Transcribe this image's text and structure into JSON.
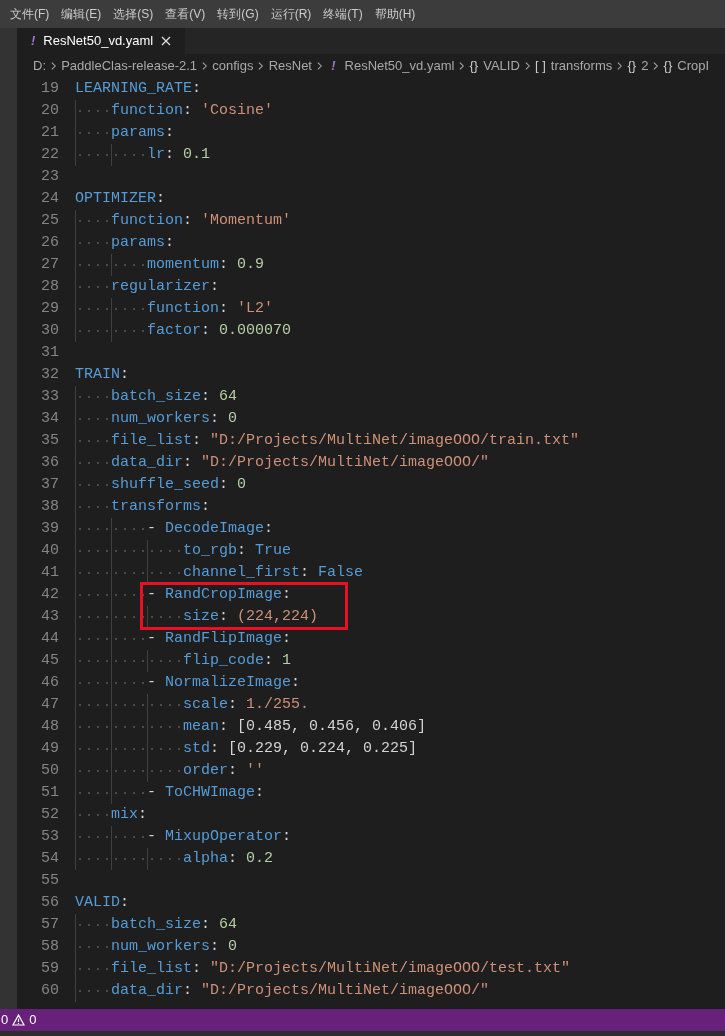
{
  "menu": [
    "文件(F)",
    "编辑(E)",
    "选择(S)",
    "查看(V)",
    "转到(G)",
    "运行(R)",
    "终端(T)",
    "帮助(H)"
  ],
  "tabs": [
    {
      "icon": "!",
      "label": "ResNet50_vd.yaml",
      "selected": true
    }
  ],
  "breadcrumb": [
    {
      "label": "D:"
    },
    {
      "label": "PaddleClas-release-2.1"
    },
    {
      "label": "configs"
    },
    {
      "label": "ResNet"
    },
    {
      "symbol": "!",
      "label": "ResNet50_vd.yaml"
    },
    {
      "symbol": "{}",
      "label": "VALID"
    },
    {
      "symbol": "[ ]",
      "label": "transforms"
    },
    {
      "symbol": "{}",
      "label": "2"
    },
    {
      "symbol": "{}",
      "label": "CropI"
    }
  ],
  "lines": [
    {
      "number": "19",
      "highlighted": false,
      "tokens": [
        {
          "kind": "key",
          "text": "LEARNING_RATE"
        },
        {
          "kind": "punct",
          "text": ":"
        }
      ],
      "children": [
        {
          "number": "20",
          "highlighted": false,
          "tokens": [
            {
              "kind": "key",
              "text": "function"
            },
            {
              "kind": "punct",
              "text": ": "
            },
            {
              "kind": "string",
              "text": "'Cosine'"
            }
          ]
        },
        {
          "number": "21",
          "highlighted": false,
          "tokens": [
            {
              "kind": "key",
              "text": "params"
            },
            {
              "kind": "punct",
              "text": ":"
            }
          ],
          "children": [
            {
              "number": "22",
              "highlighted": false,
              "tokens": [
                {
                  "kind": "key",
                  "text": "lr"
                },
                {
                  "kind": "punct",
                  "text": ": "
                },
                {
                  "kind": "number",
                  "text": "0.1"
                }
              ]
            }
          ]
        }
      ]
    },
    {
      "number": "23",
      "highlighted": false
    },
    {
      "number": "24",
      "highlighted": false,
      "tokens": [
        {
          "kind": "key",
          "text": "OPTIMIZER"
        },
        {
          "kind": "punct",
          "text": ":"
        }
      ],
      "children": [
        {
          "number": "25",
          "highlighted": false,
          "tokens": [
            {
              "kind": "key",
              "text": "function"
            },
            {
              "kind": "punct",
              "text": ": "
            },
            {
              "kind": "string",
              "text": "'Momentum'"
            }
          ]
        },
        {
          "number": "26",
          "highlighted": false,
          "tokens": [
            {
              "kind": "key",
              "text": "params"
            },
            {
              "kind": "punct",
              "text": ":"
            }
          ],
          "children": [
            {
              "number": "27",
              "highlighted": false,
              "tokens": [
                {
                  "kind": "key",
                  "text": "momentum"
                },
                {
                  "kind": "punct",
                  "text": ": "
                },
                {
                  "kind": "number",
                  "text": "0.9"
                }
              ]
            }
          ]
        },
        {
          "number": "28",
          "highlighted": false,
          "tokens": [
            {
              "kind": "key",
              "text": "regularizer"
            },
            {
              "kind": "punct",
              "text": ":"
            }
          ],
          "children": [
            {
              "number": "29",
              "highlighted": false,
              "tokens": [
                {
                  "kind": "key",
                  "text": "function"
                },
                {
                  "kind": "punct",
                  "text": ": "
                },
                {
                  "kind": "string",
                  "text": "'L2'"
                }
              ]
            },
            {
              "number": "30",
              "highlighted": false,
              "tokens": [
                {
                  "kind": "key",
                  "text": "factor"
                },
                {
                  "kind": "punct",
                  "text": ": "
                },
                {
                  "kind": "number",
                  "text": "0.000070"
                }
              ]
            }
          ]
        }
      ]
    },
    {
      "number": "31",
      "highlighted": false
    },
    {
      "number": "32",
      "highlighted": false,
      "tokens": [
        {
          "kind": "key",
          "text": "TRAIN"
        },
        {
          "kind": "punct",
          "text": ":"
        }
      ],
      "children": [
        {
          "number": "33",
          "highlighted": false,
          "tokens": [
            {
              "kind": "key",
              "text": "batch_size"
            },
            {
              "kind": "punct",
              "text": ": "
            },
            {
              "kind": "number",
              "text": "64"
            }
          ]
        },
        {
          "number": "34",
          "highlighted": false,
          "tokens": [
            {
              "kind": "key",
              "text": "num_workers"
            },
            {
              "kind": "punct",
              "text": ": "
            },
            {
              "kind": "number",
              "text": "0"
            }
          ]
        },
        {
          "number": "35",
          "highlighted": false,
          "tokens": [
            {
              "kind": "key",
              "text": "file_list"
            },
            {
              "kind": "punct",
              "text": ": "
            },
            {
              "kind": "string",
              "text": "\"D:/Projects/MultiNet/imageOOO/train.txt\""
            }
          ]
        },
        {
          "number": "36",
          "highlighted": false,
          "tokens": [
            {
              "kind": "key",
              "text": "data_dir"
            },
            {
              "kind": "punct",
              "text": ": "
            },
            {
              "kind": "string",
              "text": "\"D:/Projects/MultiNet/imageOOO/\""
            }
          ]
        },
        {
          "number": "37",
          "highlighted": false,
          "tokens": [
            {
              "kind": "key",
              "text": "shuffle_seed"
            },
            {
              "kind": "punct",
              "text": ": "
            },
            {
              "kind": "number",
              "text": "0"
            }
          ]
        },
        {
          "number": "38",
          "highlighted": false,
          "tokens": [
            {
              "kind": "key",
              "text": "transforms"
            },
            {
              "kind": "punct",
              "text": ":"
            }
          ],
          "children": [
            {
              "number": "39",
              "highlighted": false,
              "tokens": [
                {
                  "kind": "punct",
                  "text": "- "
                },
                {
                  "kind": "key",
                  "text": "DecodeImage"
                },
                {
                  "kind": "punct",
                  "text": ":"
                }
              ],
              "children": [
                {
                  "number": "40",
                  "highlighted": false,
                  "tokens": [
                    {
                      "kind": "key",
                      "text": "to_rgb"
                    },
                    {
                      "kind": "punct",
                      "text": ": "
                    },
                    {
                      "kind": "bool",
                      "text": "True"
                    }
                  ]
                },
                {
                  "number": "41",
                  "highlighted": false,
                  "tokens": [
                    {
                      "kind": "key",
                      "text": "channel_first"
                    },
                    {
                      "kind": "punct",
                      "text": ": "
                    },
                    {
                      "kind": "bool",
                      "text": "False"
                    }
                  ]
                }
              ]
            },
            {
              "number": "42",
              "highlighted": true,
              "tokens": [
                {
                  "kind": "punct",
                  "text": "- "
                },
                {
                  "kind": "key",
                  "text": "RandCropImage"
                },
                {
                  "kind": "punct",
                  "text": ":"
                }
              ],
              "children": [
                {
                  "number": "43",
                  "highlighted": true,
                  "tokens": [
                    {
                      "kind": "key",
                      "text": "size"
                    },
                    {
                      "kind": "punct",
                      "text": ": "
                    },
                    {
                      "kind": "string",
                      "text": "(224,224)"
                    }
                  ]
                }
              ]
            },
            {
              "number": "44",
              "highlighted": false,
              "tokens": [
                {
                  "kind": "punct",
                  "text": "- "
                },
                {
                  "kind": "key",
                  "text": "RandFlipImage"
                },
                {
                  "kind": "punct",
                  "text": ":"
                }
              ],
              "children": [
                {
                  "number": "45",
                  "highlighted": false,
                  "tokens": [
                    {
                      "kind": "key",
                      "text": "flip_code"
                    },
                    {
                      "kind": "punct",
                      "text": ": "
                    },
                    {
                      "kind": "number",
                      "text": "1"
                    }
                  ]
                }
              ]
            },
            {
              "number": "46",
              "highlighted": false,
              "tokens": [
                {
                  "kind": "punct",
                  "text": "- "
                },
                {
                  "kind": "key",
                  "text": "NormalizeImage"
                },
                {
                  "kind": "punct",
                  "text": ":"
                }
              ],
              "children": [
                {
                  "number": "47",
                  "highlighted": false,
                  "tokens": [
                    {
                      "kind": "key",
                      "text": "scale"
                    },
                    {
                      "kind": "punct",
                      "text": ": "
                    },
                    {
                      "kind": "string",
                      "text": "1./255."
                    }
                  ]
                },
                {
                  "number": "48",
                  "highlighted": false,
                  "tokens": [
                    {
                      "kind": "key",
                      "text": "mean"
                    },
                    {
                      "kind": "punct",
                      "text": ": [0.485, 0.456, 0.406]"
                    }
                  ]
                },
                {
                  "number": "49",
                  "highlighted": false,
                  "tokens": [
                    {
                      "kind": "key",
                      "text": "std"
                    },
                    {
                      "kind": "punct",
                      "text": ": [0.229, 0.224, 0.225]"
                    }
                  ]
                },
                {
                  "number": "50",
                  "highlighted": false,
                  "tokens": [
                    {
                      "kind": "key",
                      "text": "order"
                    },
                    {
                      "kind": "punct",
                      "text": ": "
                    },
                    {
                      "kind": "string",
                      "text": "''"
                    }
                  ]
                }
              ]
            },
            {
              "number": "51",
              "highlighted": false,
              "tokens": [
                {
                  "kind": "punct",
                  "text": "- "
                },
                {
                  "kind": "key",
                  "text": "ToCHWImage"
                },
                {
                  "kind": "punct",
                  "text": ":"
                }
              ]
            }
          ]
        },
        {
          "number": "52",
          "highlighted": false,
          "tokens": [
            {
              "kind": "key",
              "text": "mix"
            },
            {
              "kind": "punct",
              "text": ":"
            }
          ],
          "children": [
            {
              "number": "53",
              "highlighted": false,
              "tokens": [
                {
                  "kind": "punct",
                  "text": "- "
                },
                {
                  "kind": "key",
                  "text": "MixupOperator"
                },
                {
                  "kind": "punct",
                  "text": ":"
                }
              ],
              "children": [
                {
                  "number": "54",
                  "highlighted": false,
                  "tokens": [
                    {
                      "kind": "key",
                      "text": "alpha"
                    },
                    {
                      "kind": "punct",
                      "text": ": "
                    },
                    {
                      "kind": "number",
                      "text": "0.2"
                    }
                  ]
                }
              ]
            }
          ]
        }
      ]
    },
    {
      "number": "55",
      "highlighted": false
    },
    {
      "number": "56",
      "highlighted": false,
      "tokens": [
        {
          "kind": "key",
          "text": "VALID"
        },
        {
          "kind": "punct",
          "text": ":"
        }
      ],
      "children": [
        {
          "number": "57",
          "highlighted": false,
          "tokens": [
            {
              "kind": "key",
              "text": "batch_size"
            },
            {
              "kind": "punct",
              "text": ": "
            },
            {
              "kind": "number",
              "text": "64"
            }
          ]
        },
        {
          "number": "58",
          "highlighted": false,
          "tokens": [
            {
              "kind": "key",
              "text": "num_workers"
            },
            {
              "kind": "punct",
              "text": ": "
            },
            {
              "kind": "number",
              "text": "0"
            }
          ]
        },
        {
          "number": "59",
          "highlighted": false,
          "tokens": [
            {
              "kind": "key",
              "text": "file_list"
            },
            {
              "kind": "punct",
              "text": ": "
            },
            {
              "kind": "string",
              "text": "\"D:/Projects/MultiNet/imageOOO/test.txt\""
            }
          ]
        },
        {
          "number": "60",
          "highlighted": false,
          "tokens": [
            {
              "kind": "key",
              "text": "data_dir"
            },
            {
              "kind": "punct",
              "text": ": "
            },
            {
              "kind": "string",
              "text": "\"D:/Projects/MultiNet/imageOOO/\""
            }
          ]
        }
      ]
    }
  ],
  "status_bar": {
    "errors": "0",
    "warnings": "0"
  }
}
